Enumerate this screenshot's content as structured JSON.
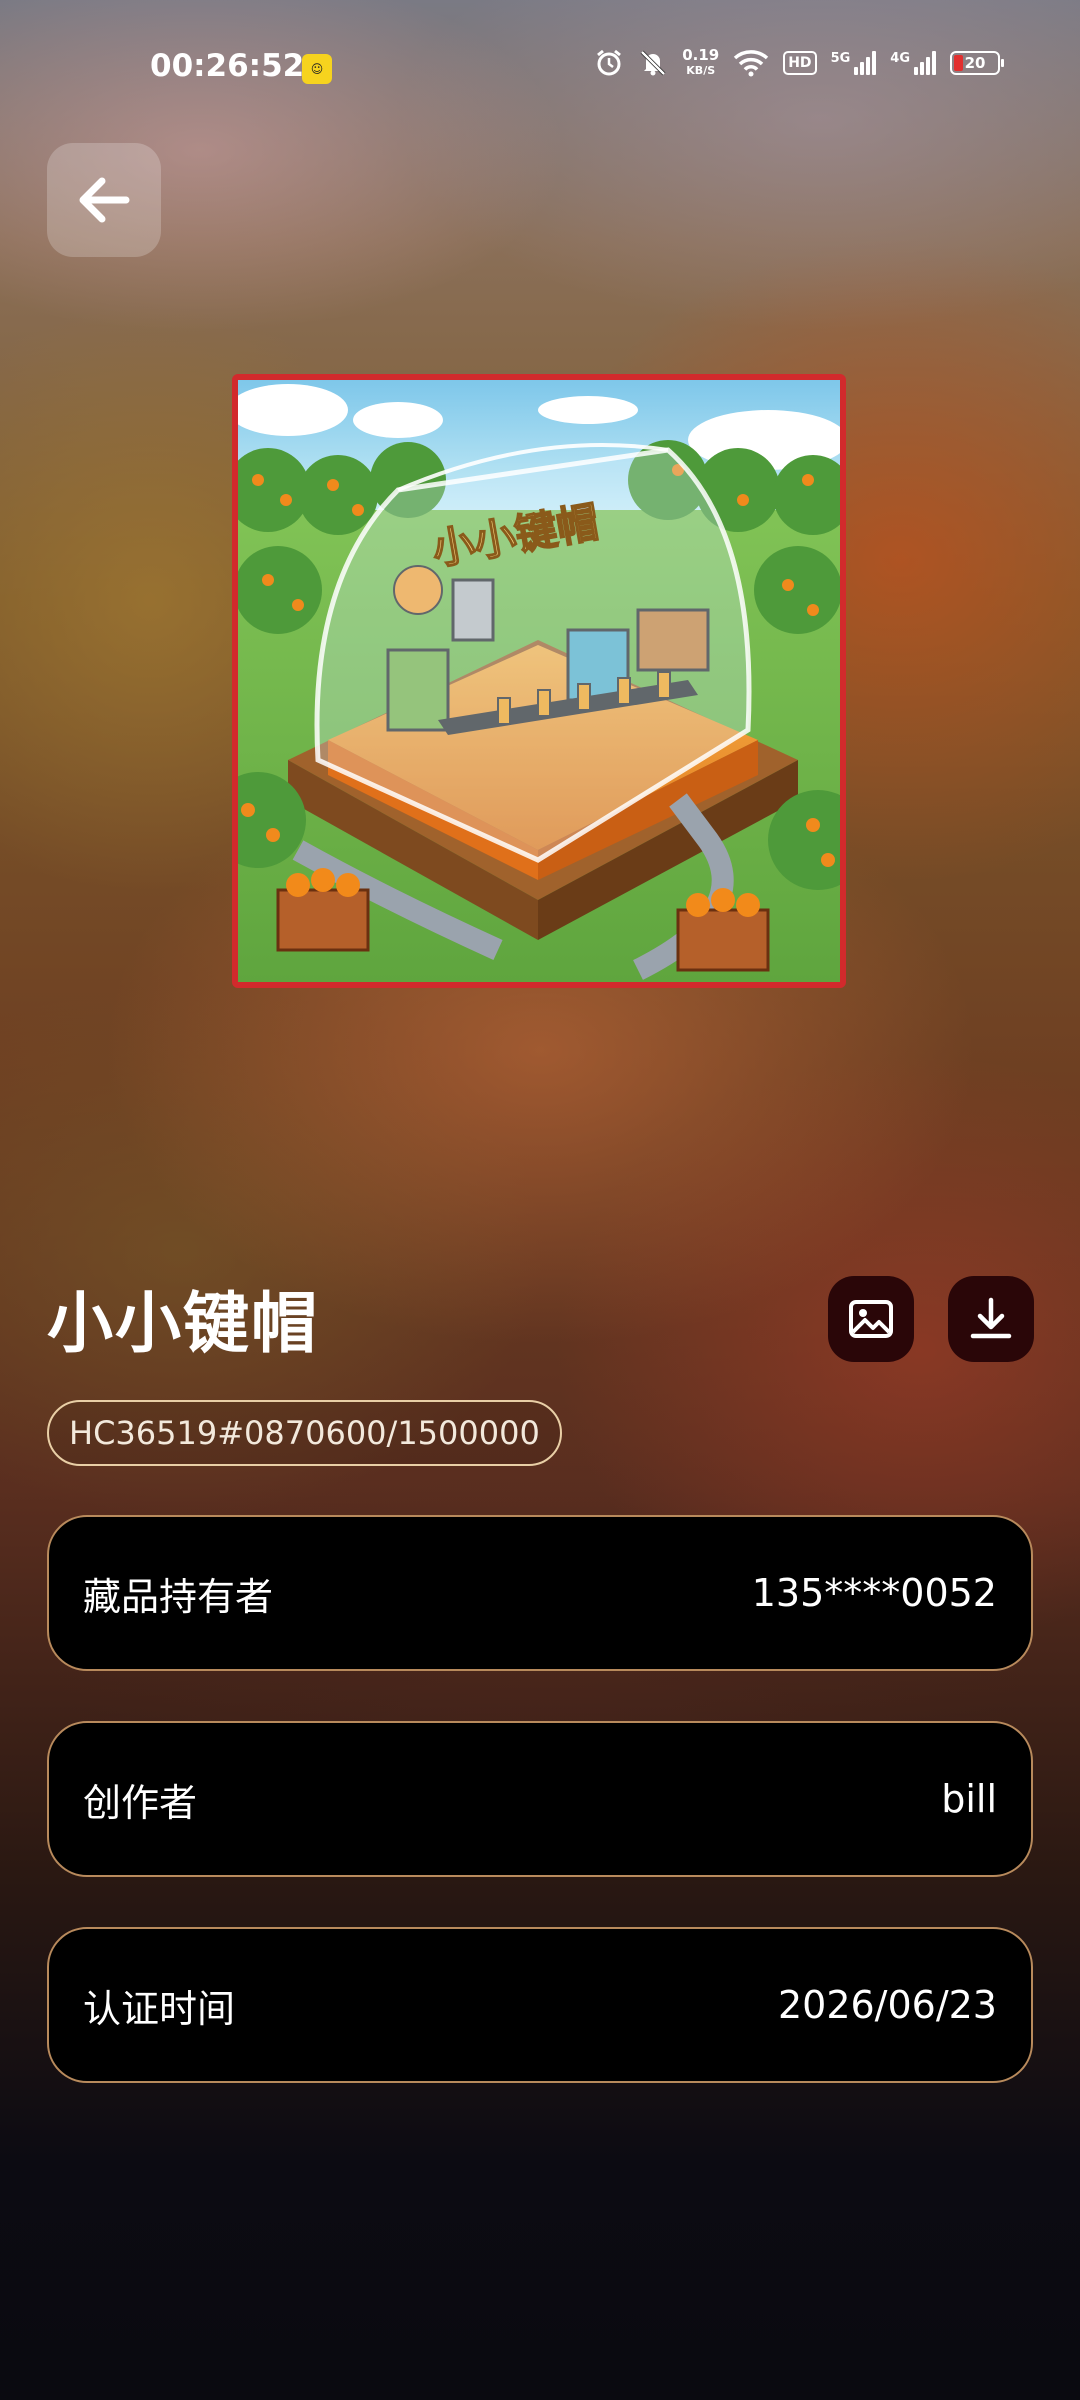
{
  "status_bar": {
    "time": "00:26:52",
    "app_badge_icon": "app-notification-icon",
    "net_speed_value": "0.19",
    "net_speed_unit": "KB/S",
    "hd_label": "HD",
    "signal_1_label": "5G",
    "signal_2_label": "4G",
    "battery_level": "20",
    "battery_color": "#e22f2f"
  },
  "header": {
    "back_icon": "arrow-left-icon"
  },
  "artwork": {
    "dome_text": "小小键帽",
    "frame_color": "#d22a2c"
  },
  "collectible": {
    "title": "小小键帽",
    "serial": "HC36519#0870600/1500000",
    "image_icon": "image-icon",
    "download_icon": "download-icon"
  },
  "info": [
    {
      "label": "藏品持有者",
      "value": "135****0052"
    },
    {
      "label": "创作者",
      "value": "bill"
    },
    {
      "label": "认证时间",
      "value": "2026/06/23"
    }
  ],
  "colors": {
    "card_border": "#b88a5c",
    "serial_border": "#e9cfa6",
    "icon_button_bg": "#2a0608"
  }
}
